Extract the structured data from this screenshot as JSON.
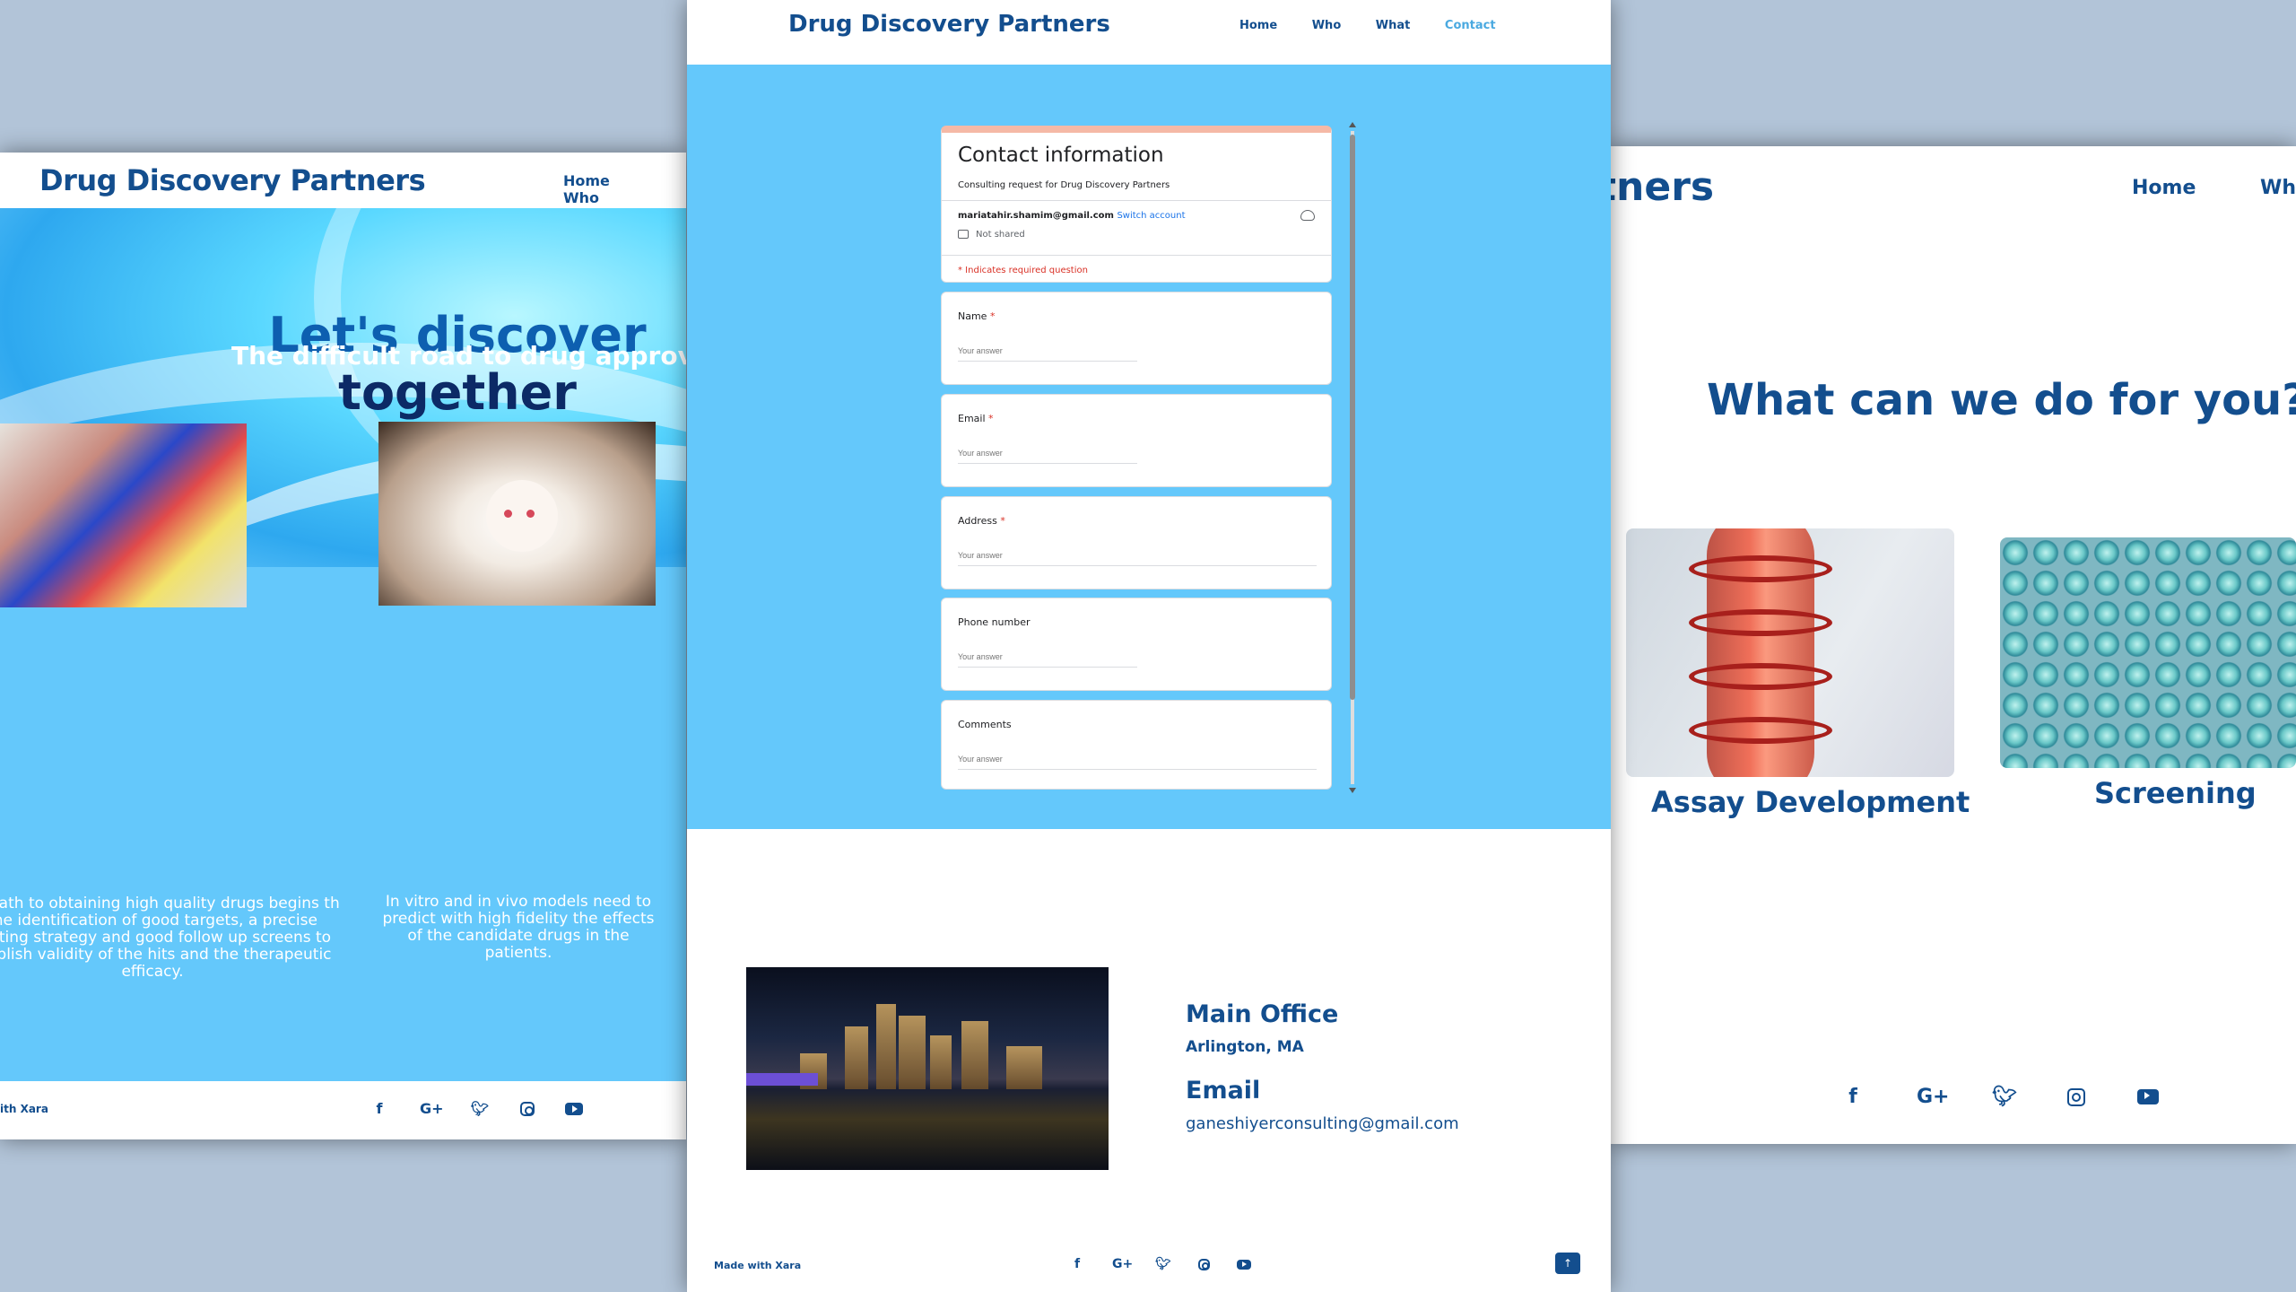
{
  "left": {
    "logo": "Drug Discovery Partners",
    "nav": [
      "Home",
      "Who"
    ],
    "hero_line1": "Let's discover",
    "hero_line2": "together",
    "road_title": "The difficult road to drug approvals",
    "caption1": "he path to obtaining high quality drugs begins th the identification of good targets, a precise rgeting strategy and good follow up screens to stablish validity of the hits and the therapeutic efficacy.",
    "caption2": "In vitro and in vivo models need to predict with high fidelity the effects of the candidate drugs in the patients.",
    "made_with": "ith Xara",
    "social": [
      "facebook-icon",
      "google-plus-icon",
      "twitter-icon",
      "instagram-icon",
      "youtube-icon"
    ]
  },
  "center": {
    "logo": "Drug Discovery Partners",
    "nav": {
      "home": "Home",
      "who": "Who",
      "what": "What",
      "contact": "Contact"
    },
    "form": {
      "title": "Contact information",
      "subtitle": "Consulting request for Drug Discovery Partners",
      "account": "mariatahir.shamim@gmail.com",
      "switch": "Switch account",
      "not_shared": "Not shared",
      "required_note": "* Indicates required question",
      "placeholder": "Your answer",
      "questions": [
        {
          "label": "Name",
          "required": "*"
        },
        {
          "label": "Email",
          "required": "*"
        },
        {
          "label": "Address",
          "required": "*"
        },
        {
          "label": "Phone number",
          "required": ""
        },
        {
          "label": "Comments",
          "required": ""
        }
      ]
    },
    "office_title": "Main Office",
    "office_city": "Arlington, MA",
    "email_title": "Email",
    "email": "ganeshiyerconsulting@gmail.com",
    "made_with": "Made with Xara",
    "social": [
      "facebook-icon",
      "google-plus-icon",
      "twitter-icon",
      "instagram-icon",
      "youtube-icon"
    ]
  },
  "right": {
    "logo": "ery Partners",
    "nav": [
      "Home",
      "Who"
    ],
    "heading": "What can we do for you?",
    "card1": "Assay Development",
    "card2": "Screening",
    "social": [
      "facebook-icon",
      "google-plus-icon",
      "twitter-icon",
      "instagram-icon",
      "youtube-icon"
    ]
  },
  "colors": {
    "brand": "#134e8e",
    "sky": "#64c8fb",
    "active_nav": "#4aa9e0",
    "required": "#d93025"
  }
}
